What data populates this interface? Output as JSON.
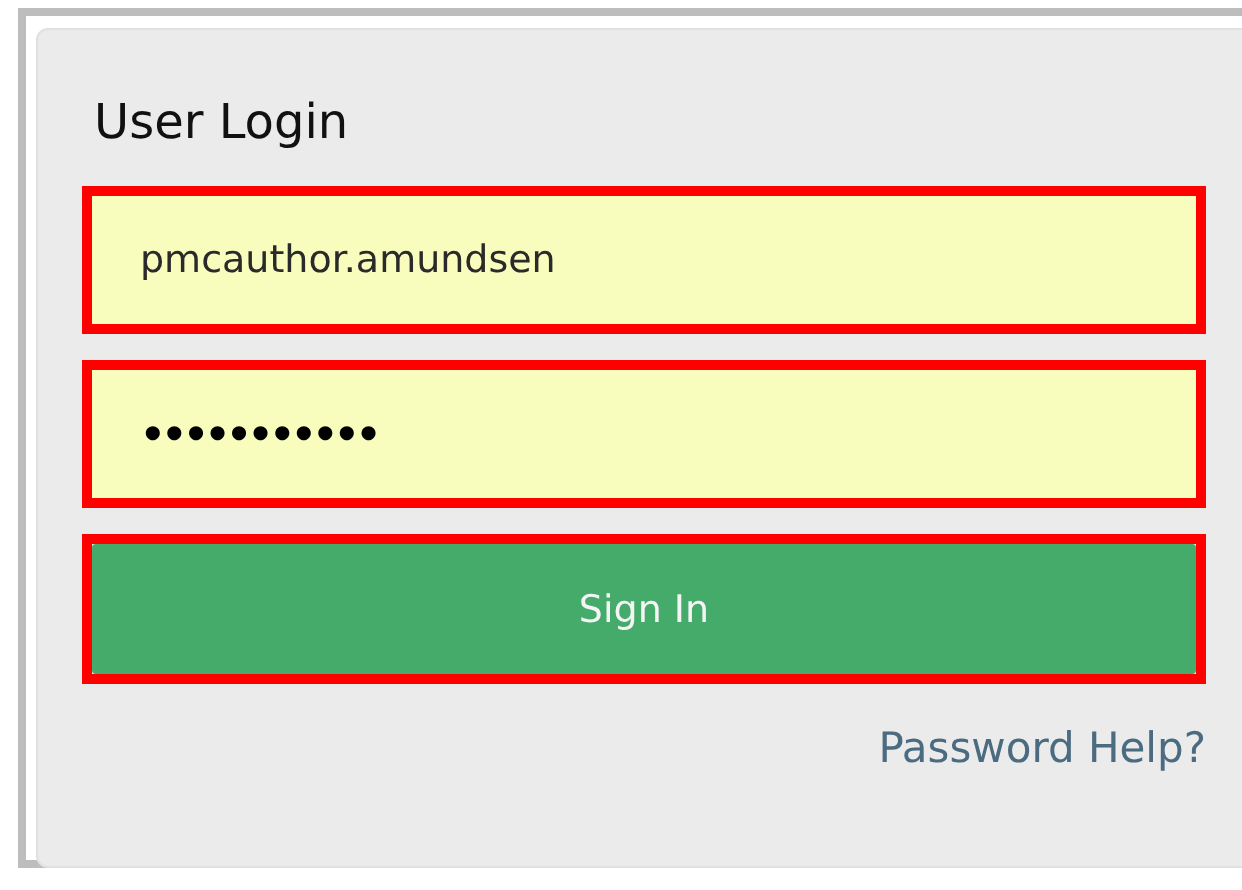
{
  "panel": {
    "title": "User Login"
  },
  "fields": [
    {
      "kind": "text",
      "value": "pmcauthor.amundsen",
      "highlighted": true
    },
    {
      "kind": "password",
      "value": "•••••••••••",
      "highlighted": true
    }
  ],
  "button": {
    "label": "Sign In",
    "highlighted": true
  },
  "link": {
    "label": "Password Help?"
  }
}
